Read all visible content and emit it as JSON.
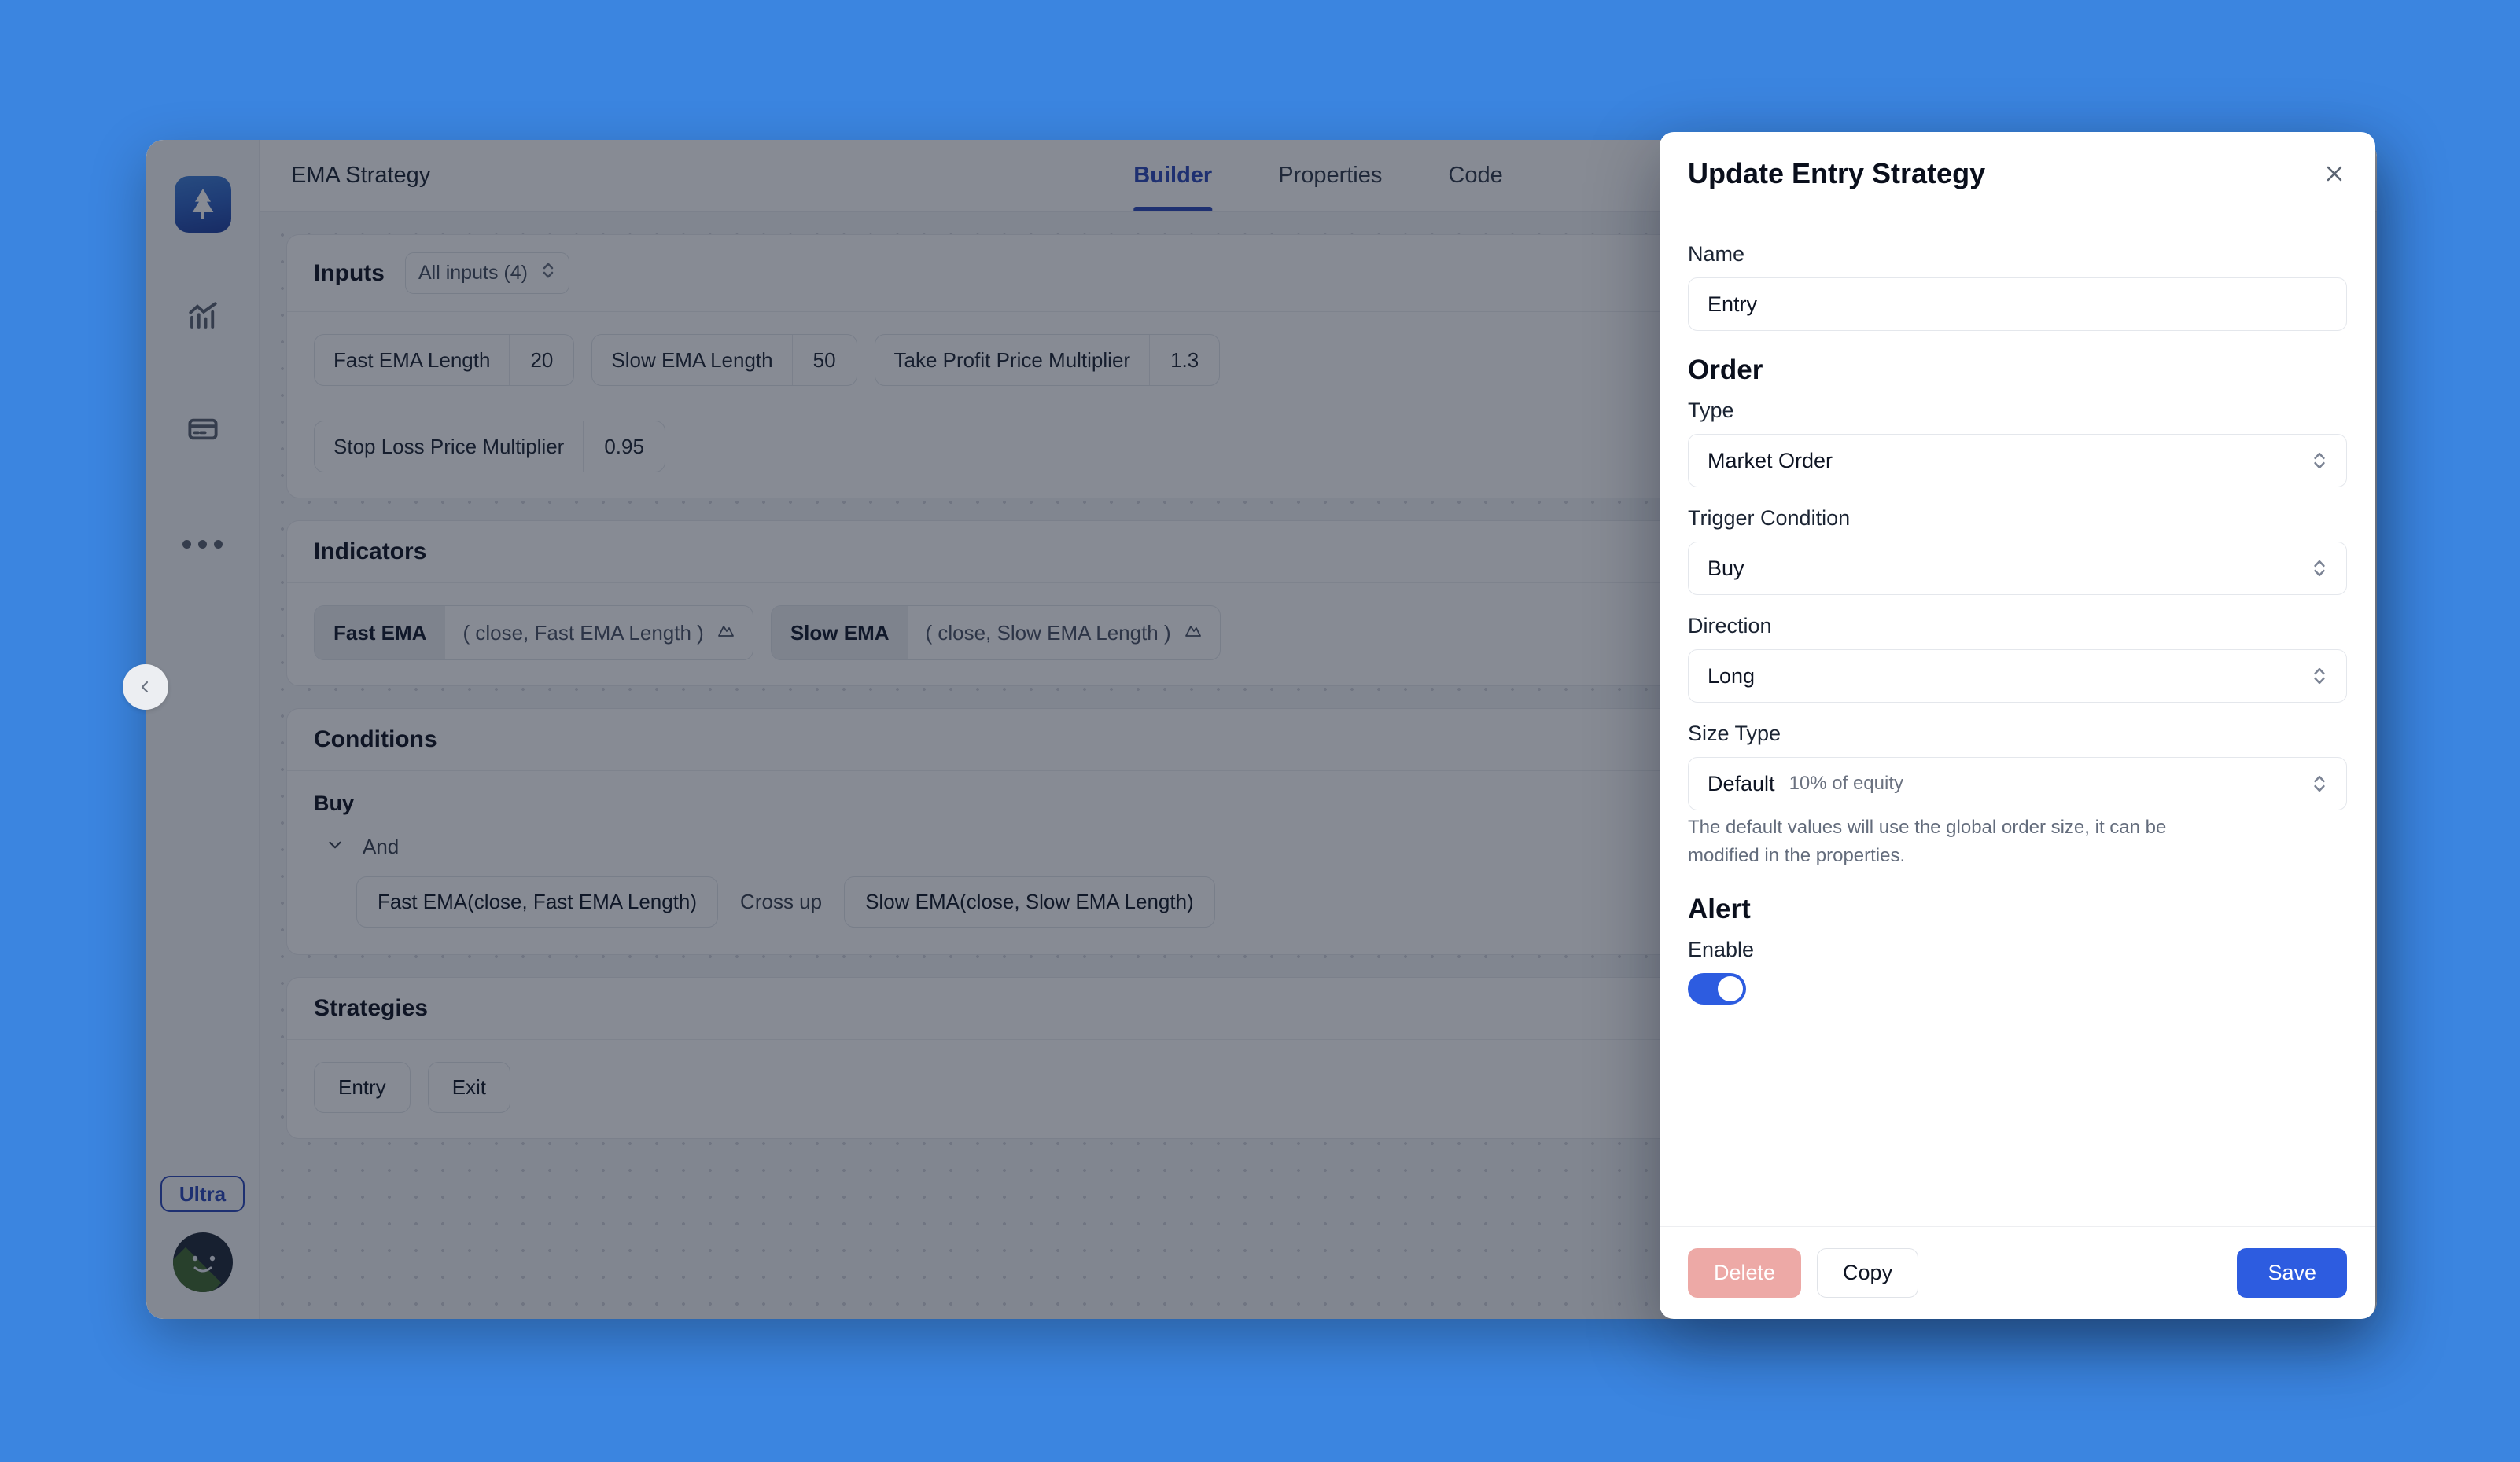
{
  "app": {
    "doc_title": "EMA Strategy",
    "tabs": [
      {
        "label": "Builder",
        "active": true
      },
      {
        "label": "Properties",
        "active": false
      },
      {
        "label": "Code",
        "active": false
      }
    ],
    "rail": {
      "logo_icon": "pine-tree-logo-icon",
      "items": [
        {
          "icon": "analytics-chart-icon"
        },
        {
          "icon": "credit-card-icon"
        },
        {
          "icon": "more-dots-icon"
        }
      ],
      "plan_badge": "Ultra",
      "avatar": "user-avatar"
    },
    "collapse_handle_icon": "chevron-left-icon"
  },
  "sections": {
    "inputs": {
      "title": "Inputs",
      "filter_label": "All inputs (4)",
      "actions": [
        "add-icon",
        "sort-icon"
      ],
      "items": [
        {
          "label": "Fast EMA Length",
          "value": "20"
        },
        {
          "label": "Slow EMA Length",
          "value": "50"
        },
        {
          "label": "Take Profit Price Multiplier",
          "value": "1.3"
        },
        {
          "label": "Stop Loss Price Multiplier",
          "value": "0.95"
        }
      ]
    },
    "indicators": {
      "title": "Indicators",
      "actions": [
        "add-icon",
        "sort-icon"
      ],
      "items": [
        {
          "name": "Fast EMA",
          "params": "( close, Fast EMA Length )"
        },
        {
          "name": "Slow EMA",
          "params": "( close, Slow EMA Length )"
        }
      ]
    },
    "conditions": {
      "title": "Conditions",
      "actions": [
        "chevron-updown-icon",
        "add-icon",
        "sort-icon"
      ],
      "side_label": "Buy",
      "operator": "And",
      "expression": {
        "left": "Fast EMA(close, Fast EMA Length)",
        "op": "Cross up",
        "right": "Slow EMA(close, Slow EMA Length)"
      }
    },
    "strategies": {
      "title": "Strategies",
      "actions": [
        "add-icon",
        "sort-icon"
      ],
      "items": [
        "Entry",
        "Exit"
      ]
    }
  },
  "modal": {
    "title": "Update Entry Strategy",
    "close_icon": "close-icon",
    "name": {
      "label": "Name",
      "value": "Entry"
    },
    "order": {
      "heading": "Order",
      "type": {
        "label": "Type",
        "value": "Market Order"
      },
      "trigger_condition": {
        "label": "Trigger Condition",
        "value": "Buy"
      },
      "direction": {
        "label": "Direction",
        "value": "Long"
      },
      "size_type": {
        "label": "Size Type",
        "value": "Default",
        "hint": "10% of equity"
      },
      "help": "The default values will use the global order size, it can be modified in the properties."
    },
    "alert": {
      "heading": "Alert",
      "enable_label": "Enable",
      "enabled": true
    },
    "footer": {
      "delete_label": "Delete",
      "copy_label": "Copy",
      "save_label": "Save"
    }
  },
  "colors": {
    "desktop": "#3b85e0",
    "accent": "#2d5ce0",
    "tab_active": "#2d49b8",
    "danger_muted": "#eda9a6"
  }
}
